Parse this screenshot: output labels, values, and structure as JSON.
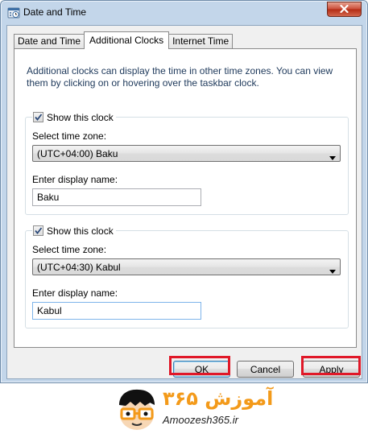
{
  "window": {
    "title": "Date and Time",
    "accent_color": "#e01828"
  },
  "tabs": [
    {
      "label": "Date and Time",
      "active": false
    },
    {
      "label": "Additional Clocks",
      "active": true
    },
    {
      "label": "Internet Time",
      "active": false
    }
  ],
  "panel": {
    "intro": "Additional clocks can display the time in other time zones. You can view them by clicking on or hovering over the taskbar clock.",
    "clock1": {
      "show_label": "Show this clock",
      "checked": true,
      "timezone_label": "Select time zone:",
      "timezone_value": "(UTC+04:00) Baku",
      "name_label": "Enter display name:",
      "name_value": "Baku"
    },
    "clock2": {
      "show_label": "Show this clock",
      "checked": true,
      "timezone_label": "Select time zone:",
      "timezone_value": "(UTC+04:30) Kabul",
      "name_label": "Enter display name:",
      "name_value": "Kabul"
    }
  },
  "buttons": {
    "ok": "OK",
    "cancel": "Cancel",
    "apply": "Apply"
  },
  "logo": {
    "persian_text": "آموزش ۳۶۵",
    "url": "Amoozesh365.ir",
    "brand_color": "#f39a1a"
  }
}
